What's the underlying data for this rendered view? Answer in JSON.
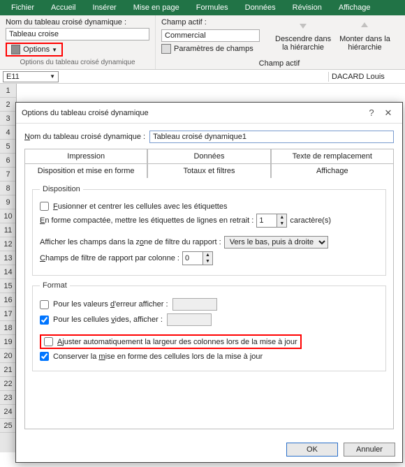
{
  "ribbon": {
    "tabs": [
      "Fichier",
      "Accueil",
      "Insérer",
      "Mise en page",
      "Formules",
      "Données",
      "Révision",
      "Affichage"
    ],
    "group_pivot": {
      "label_name": "Nom du tableau croisé dynamique :",
      "name_value": "Tableau croise",
      "options_btn": "Options",
      "group_name": "Options du tableau croisé dynamique"
    },
    "group_field": {
      "label": "Champ actif :",
      "value": "Commercial",
      "settings_btn": "Paramètres de champs",
      "group_name": "Champ actif"
    },
    "drill_down": "Descendre dans\nla hiérarchie",
    "drill_up": "Monter dans la\nhiérarchie"
  },
  "cell": {
    "ref": "E11",
    "header_val": "DACARD Louis"
  },
  "dialog": {
    "title": "Options du tableau croisé dynamique",
    "name_label": "Nom du tableau croisé dynamique :",
    "name_value": "Tableau croisé dynamique1",
    "tabs_back": [
      "Impression",
      "Données",
      "Texte de remplacement"
    ],
    "tabs_front": [
      "Disposition et mise en forme",
      "Totaux et filtres",
      "Affichage"
    ],
    "disposition_legend": "Disposition",
    "merge_label": "Fusionner et centrer les cellules avec les étiquettes",
    "indent_pre": "En forme compactée, mettre les étiquettes de lignes en retrait :",
    "indent_val": "1",
    "indent_post": "caractère(s)",
    "filter_pos_label": "Afficher les champs dans la zone de filtre du rapport :",
    "filter_pos_value": "Vers le bas, puis à droite",
    "filter_cols_label": "Champs de filtre de rapport par colonne :",
    "filter_cols_val": "0",
    "format_legend": "Format",
    "err_label": "Pour les valeurs d'erreur afficher :",
    "empty_label": "Pour les cellules vides, afficher :",
    "autofit_label": "Ajuster automatiquement la largeur des colonnes lors de la mise à jour",
    "preserve_label": "Conserver la mise en forme des cellules lors de la mise à jour",
    "ok": "OK",
    "cancel": "Annuler"
  }
}
